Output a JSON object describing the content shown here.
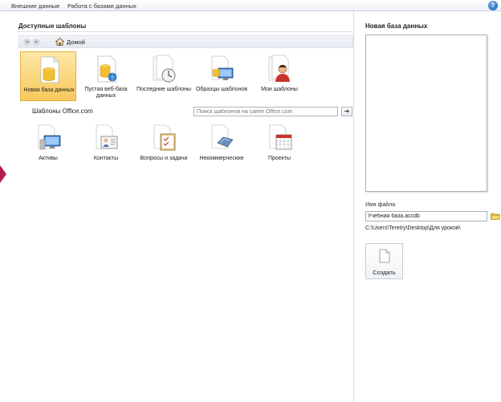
{
  "ribbon": {
    "tabs": [
      "Внешние данные",
      "Работа с базами данных"
    ],
    "help_icon": "help-icon"
  },
  "templates": {
    "title": "Доступные шаблоны",
    "nav": {
      "back_icon": "back-arrow-icon",
      "forward_icon": "forward-arrow-icon",
      "home_icon": "home-icon",
      "home_label": "Домой"
    },
    "local": [
      {
        "label": "Новая база данных",
        "icon": "new-database-icon",
        "selected": true
      },
      {
        "label": "Пустая веб-база данных",
        "icon": "blank-web-database-icon",
        "selected": false
      },
      {
        "label": "Последние шаблоны",
        "icon": "recent-templates-icon",
        "selected": false
      },
      {
        "label": "Образцы шаблонов",
        "icon": "sample-templates-icon",
        "selected": false
      },
      {
        "label": "Мои шаблоны",
        "icon": "my-templates-icon",
        "selected": false
      }
    ],
    "office": {
      "label": "Шаблоны Office.com",
      "search_placeholder": "Поиск шаблонов на сайте Office.com",
      "search_button": "➔",
      "items": [
        {
          "label": "Активы",
          "icon": "assets-icon"
        },
        {
          "label": "Контакты",
          "icon": "contacts-icon"
        },
        {
          "label": "Вопросы и задачи",
          "icon": "issues-tasks-icon"
        },
        {
          "label": "Некоммерческие",
          "icon": "nonprofit-icon"
        },
        {
          "label": "Проекты",
          "icon": "projects-icon"
        }
      ]
    }
  },
  "new_db": {
    "title": "Новая база данных",
    "filename_label": "Имя файла",
    "filename_value": "Учебная база.accdb",
    "path": "C:\\Users\\Teretry\\Desktop\\Для уроков\\",
    "create_label": "Создать"
  },
  "colors": {
    "selected_tile": "#f8c85b",
    "accent_marker": "#b01e52"
  }
}
